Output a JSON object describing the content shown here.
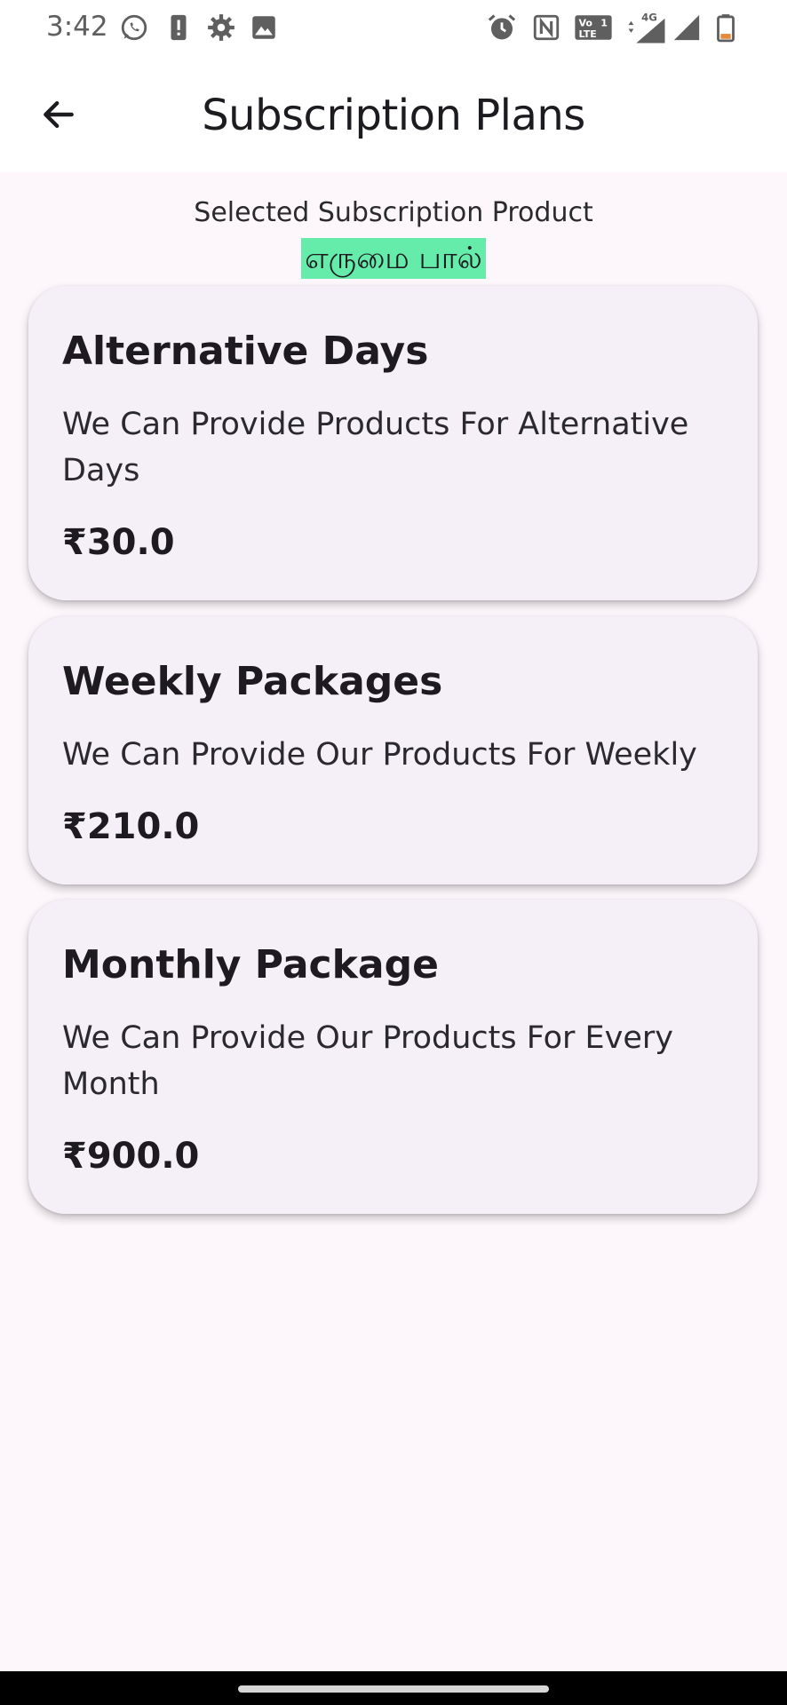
{
  "status_bar": {
    "time": "3:42",
    "left_icons": [
      "whatsapp-icon",
      "alert-icon",
      "settings-icon",
      "image-icon"
    ],
    "right_icons": [
      "alarm-icon",
      "nfc-icon",
      "volte-icon",
      "data-4g-icon",
      "signal-icon",
      "signal-icon",
      "battery-icon"
    ],
    "volte_text": "Vo LTE 1",
    "network_text": "4G"
  },
  "app_bar": {
    "title": "Subscription Plans",
    "back_icon": "arrow-back-icon"
  },
  "selected": {
    "label": "Selected Subscription Product",
    "product_name": "எருமை பால்",
    "highlight_color": "#66ecaa"
  },
  "plans": [
    {
      "title": "Alternative Days",
      "description": "We Can Provide Products For Alternative Days",
      "price": "₹30.0"
    },
    {
      "title": "Weekly Packages",
      "description": "We Can Provide Our Products For Weekly",
      "price": "₹210.0"
    },
    {
      "title": "Monthly Package",
      "description": "We Can Provide Our Products For Every Month",
      "price": "₹900.0"
    }
  ],
  "colors": {
    "background": "#fdf7fb",
    "card": "#f5eff7",
    "app_bar": "#ffffff"
  }
}
